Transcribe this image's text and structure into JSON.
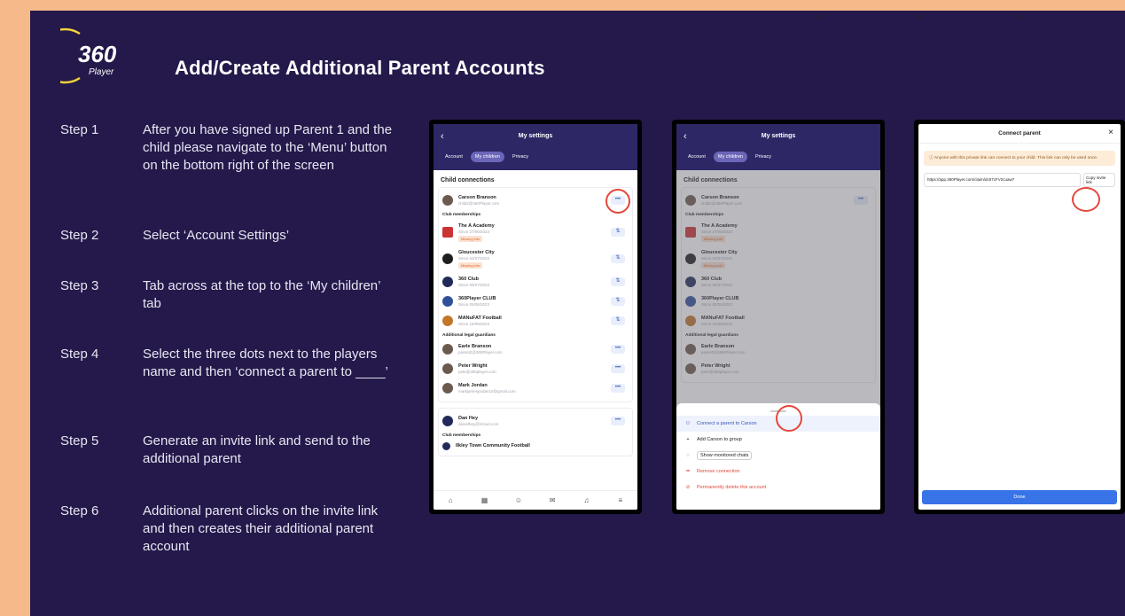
{
  "page": {
    "title": "Add/Create Additional Parent Accounts",
    "logo": {
      "number": "360",
      "word": "Player"
    },
    "colors": {
      "background": "#24194a",
      "border": "#f6b98a",
      "accent": "#e5473c"
    }
  },
  "steps": [
    {
      "label": "Step 1",
      "text": "After you have signed up Parent 1 and the child please navigate to the ‘Menu’ button on the bottom right of the screen"
    },
    {
      "label": "Step 2",
      "text": "Select ‘Account Settings’"
    },
    {
      "label": "Step 3",
      "text": "Tab across at the top to the ‘My children’ tab"
    },
    {
      "label": "Step 4",
      "text": "Select the three dots next to the players name and then ‘connect a parent to ____’"
    },
    {
      "label": "Step 5",
      "text": "Generate an invite link and send to the additional parent"
    },
    {
      "label": "Step 6",
      "text": "Additional parent clicks on the invite link and then creates their additional parent account"
    }
  ],
  "screen1": {
    "header": "My settings",
    "tabs": [
      "Account",
      "My children",
      "Privacy"
    ],
    "section": "Child connections",
    "child": {
      "name": "Carson Branson",
      "email": "child2@360Player.com"
    },
    "club_heading": "Club memberships",
    "clubs": [
      {
        "name": "The A Academy",
        "since": "Since 27/05/2023",
        "badge": "Missing info"
      },
      {
        "name": "Gloucester City",
        "since": "Since 04/07/2023",
        "badge": "Missing info"
      },
      {
        "name": "360 Club",
        "since": "Since 05/07/2023",
        "badge": ""
      },
      {
        "name": "360Player CLUB",
        "since": "Since 05/06/2023",
        "badge": ""
      },
      {
        "name": "MANuFAT Football",
        "since": "Since 16/06/2023",
        "badge": ""
      }
    ],
    "guardians_heading": "Additional legal guardians",
    "guardians": [
      {
        "name": "Earle Branson",
        "email": "parent2@360Player.com"
      },
      {
        "name": "Peter Wright",
        "email": "pete@360player.com"
      },
      {
        "name": "Mark Jordan",
        "email": "markjamesjordan10@gmail.com"
      }
    ],
    "second_child": {
      "name": "Dan Hey",
      "email": "danielhey@icloud.com"
    },
    "second_club": "Ilkley Town Community Football",
    "nav": [
      "Home",
      "Calendar",
      "Team",
      "Chat",
      "Notifications",
      "Menu"
    ]
  },
  "screen2": {
    "menu": [
      {
        "icon": "person-plus-icon",
        "label": "Connect a parent to Carson",
        "style": "blue"
      },
      {
        "icon": "plus-icon",
        "label": "Add Carson to group",
        "style": "normal"
      },
      {
        "icon": "chat-icon",
        "label": "Show monitored chats",
        "style": "chip"
      },
      {
        "icon": "unlink-icon",
        "label": "Remove connection",
        "style": "red"
      },
      {
        "icon": "warning-icon",
        "label": "Permanently delete this account",
        "style": "red"
      }
    ]
  },
  "screen3": {
    "title": "Connect parent",
    "warning": "Anyone with this private link can connect to your child. This link can only be used once.",
    "link": "https://app.360Player.com/claim/dc67cFV2cuaw7",
    "copy_label": "Copy invite link",
    "done_label": "Done"
  }
}
